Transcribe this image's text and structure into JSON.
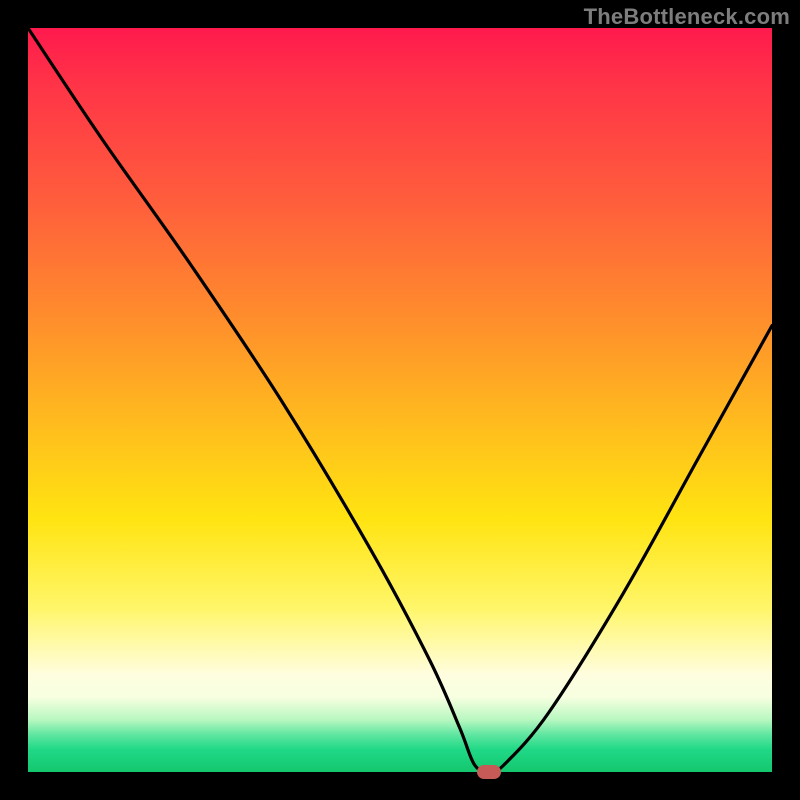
{
  "watermark": "TheBottleneck.com",
  "colors": {
    "frame": "#000000",
    "curve": "#000000",
    "marker": "#c65a57"
  },
  "chart_data": {
    "type": "line",
    "title": "",
    "xlabel": "",
    "ylabel": "",
    "xlim": [
      0,
      100
    ],
    "ylim": [
      0,
      100
    ],
    "grid": false,
    "series": [
      {
        "name": "bottleneck-curve",
        "x": [
          0,
          10,
          22,
          34,
          46,
          54,
          58,
          60,
          62,
          64,
          70,
          80,
          90,
          100
        ],
        "values": [
          100,
          85,
          68,
          50,
          30,
          15,
          6,
          1,
          0,
          1,
          8,
          24,
          42,
          60
        ]
      }
    ],
    "marker": {
      "x": 62,
      "y": 0
    },
    "note": "Values are read off by visual estimation (no axes/ticks present). y=100 is top of plot, y=0 is bottom. The curve minimum (~0%) is near x≈62 where the red marker sits."
  }
}
